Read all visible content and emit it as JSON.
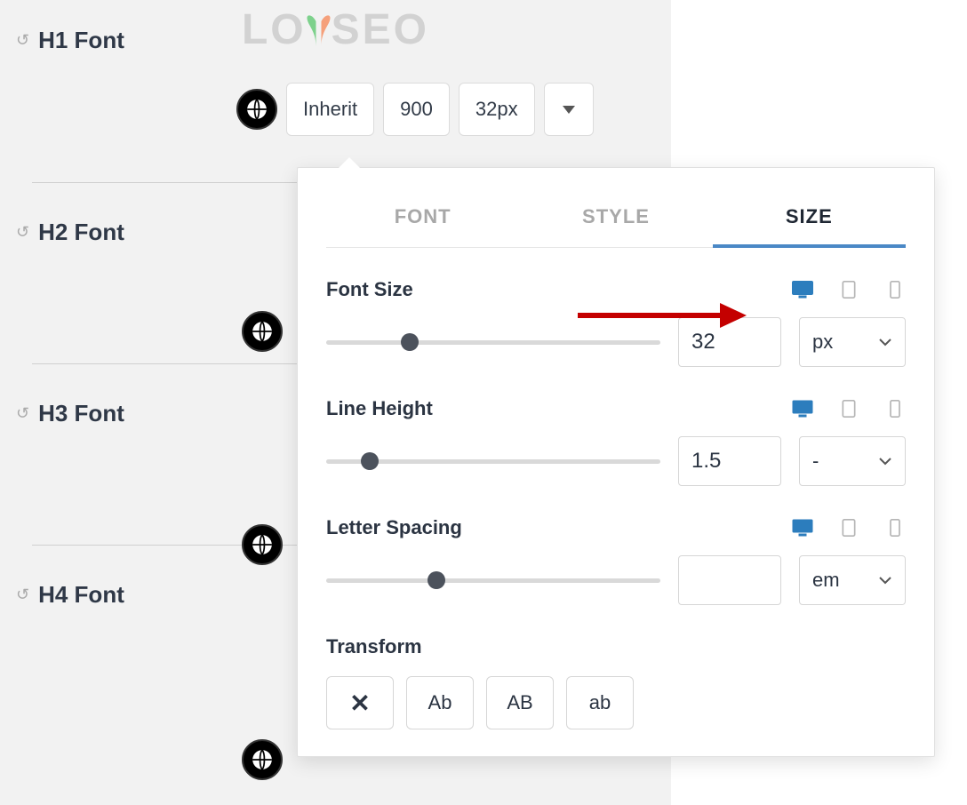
{
  "watermark": {
    "left": "LO",
    "right": "SEO"
  },
  "rows": [
    {
      "label": "H1 Font",
      "chips": {
        "family": "Inherit",
        "weight": "900",
        "size": "32px"
      }
    },
    {
      "label": "H2 Font"
    },
    {
      "label": "H3 Font"
    },
    {
      "label": "H4 Font"
    }
  ],
  "popover": {
    "tabs": {
      "font": "FONT",
      "style": "STYLE",
      "size": "SIZE"
    },
    "font_size": {
      "label": "Font Size",
      "value": "32",
      "unit": "px",
      "slider_pct": 25
    },
    "line_height": {
      "label": "Line Height",
      "value": "1.5",
      "unit": "-",
      "slider_pct": 13
    },
    "letter_spacing": {
      "label": "Letter Spacing",
      "value": "",
      "unit": "em",
      "slider_pct": 33
    },
    "transform": {
      "label": "Transform",
      "options": {
        "capitalize": "Ab",
        "upper": "AB",
        "lower": "ab"
      }
    }
  }
}
